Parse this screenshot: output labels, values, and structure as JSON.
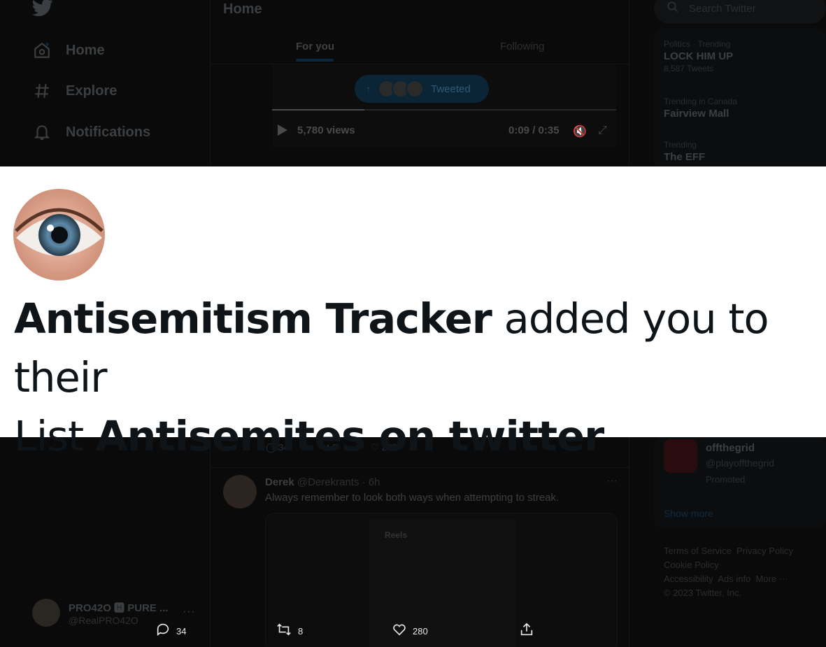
{
  "left_nav": {
    "items": [
      {
        "label": "Home",
        "icon": "home-icon"
      },
      {
        "label": "Explore",
        "icon": "hashtag-icon"
      },
      {
        "label": "Notifications",
        "icon": "bell-icon"
      }
    ],
    "account": {
      "name": "PRO42O 🅷 PURE ...",
      "handle": "@RealPRO42O",
      "more": "···"
    }
  },
  "center": {
    "title": "Home",
    "tabs": [
      "For you",
      "Following"
    ],
    "tweeted_pill": "Tweeted",
    "video": {
      "views": "5,780 views",
      "time": "0:09 / 0:35"
    },
    "tweet2": {
      "name": "Derek",
      "handle": "@Derekrants · 6h",
      "text": "Always remember to look both ways when attempting to streak.",
      "media_label": "Reels"
    }
  },
  "actions": {
    "reply_count": "34",
    "retweet_count": "8",
    "like_count": "280"
  },
  "right": {
    "search_placeholder": "Search Twitter",
    "trends": [
      {
        "context": "Politics · Trending",
        "title": "LOCK HIM UP",
        "count": "8,587 Tweets"
      },
      {
        "context": "Trending in Canada",
        "title": "Fairview Mall",
        "count": ""
      },
      {
        "context": "Trending",
        "title": "The EFF",
        "count": ""
      }
    ],
    "follow": {
      "name": "offthegrid",
      "handle": "@playoffthegrid",
      "promoted": "Promoted",
      "show_more": "Show more"
    },
    "footer": [
      "Terms of Service",
      "Privacy Policy",
      "Cookie Policy",
      "Accessibility",
      "Ads info",
      "More ···",
      "© 2023 Twitter, Inc."
    ]
  },
  "notification": {
    "actor": "Antisemitism Tracker",
    "verb": " added you to their",
    "list_word": "List ",
    "list_name": "Antisemites on twitter"
  }
}
